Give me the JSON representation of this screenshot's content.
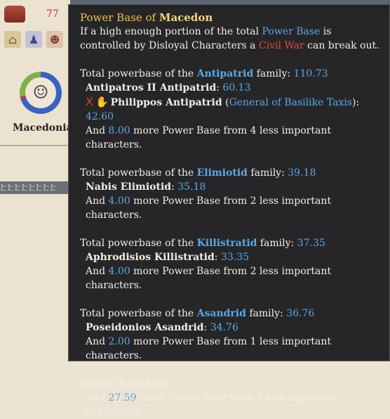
{
  "sidebar": {
    "population_value": "77",
    "country_name": "Macedonia",
    "greek_pattern": "ԷԷԷԷԷԷԷԷ"
  },
  "tooltip": {
    "title_prefix": "Power Base of ",
    "title_country": "Macedon",
    "intro_1": "If a high enough portion of the total ",
    "intro_power_base": "Power Base",
    "intro_2": " is controlled by Disloyal Characters a ",
    "intro_civil_war": "Civil War",
    "intro_3": " can break out.",
    "families": [
      {
        "prefix": "Total powerbase of the ",
        "name": "Antipatrid",
        "suffix": " family: ",
        "value": "110.73",
        "members": [
          {
            "name": "Antipatros II Antipatrid",
            "value": "60.13"
          },
          {
            "name": "Philippos Antipatrid",
            "office": "General of Basilike Taxis",
            "value": "42.60",
            "mark": "X"
          }
        ],
        "more_prefix": "And ",
        "more_value": "8.00",
        "more_suffix": " more Power Base from 4 less important characters."
      },
      {
        "prefix": "Total powerbase of the ",
        "name": "Elimiotid",
        "suffix": " family: ",
        "value": "39.18",
        "members": [
          {
            "name": "Nabis Elimiotid",
            "value": "35.18"
          }
        ],
        "more_prefix": "And ",
        "more_value": "4.00",
        "more_suffix": " more Power Base from 2 less important characters."
      },
      {
        "prefix": "Total powerbase of the ",
        "name": "Killistratid",
        "suffix": " family: ",
        "value": "37.35",
        "members": [
          {
            "name": "Aphrodisios Killistratid",
            "value": "33.35"
          }
        ],
        "more_prefix": "And ",
        "more_value": "4.00",
        "more_suffix": " more Power Base from 2 less important characters."
      },
      {
        "prefix": "Total powerbase of the ",
        "name": "Asandrid",
        "suffix": " family: ",
        "value": "36.76",
        "members": [
          {
            "name": "Poseidonios Asandrid",
            "value": "34.76"
          }
        ],
        "more_prefix": "And ",
        "more_value": "2.00",
        "more_suffix": " more Power Base from 1 less important characters."
      }
    ],
    "minor_label": "Minor characters:",
    "minor_prefix": "And ",
    "minor_value": "27.59",
    "minor_suffix": " more Power Base from 4 less important characters."
  }
}
